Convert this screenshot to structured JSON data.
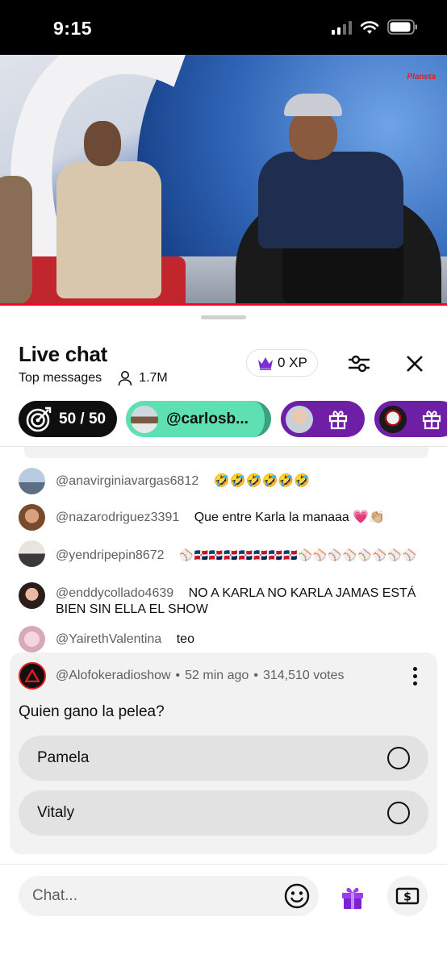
{
  "status_bar": {
    "time": "9:15"
  },
  "video": {
    "channel_logo": "Planeta"
  },
  "chat_panel": {
    "title": "Live chat",
    "mode": "Top messages",
    "viewers": "1.7M",
    "xp": "0 XP",
    "goal_pill": "50 / 50",
    "user_pill": "@carlosb...",
    "accent_colors": {
      "user_pill": "#5fe0b3",
      "gift_pill": "#6f1fa6",
      "progress": "#ff0033"
    }
  },
  "messages": [
    {
      "author": "@anavirginiavargas6812",
      "text": "🤣🤣🤣🤣🤣🤣"
    },
    {
      "author": "@nazarodriguez3391",
      "text": "Que entre Karla la manaaa 💗👏🏼"
    },
    {
      "author": "@yendripepin8672",
      "text": "⚾🇩🇴🇩🇴🇩🇴🇩🇴🇩🇴🇩🇴🇩🇴⚾⚾⚾⚾⚾⚾⚾⚾"
    },
    {
      "author": "@enddycollado4639",
      "text": "NO A KARLA NO KARLA JAMAS ESTÁ BIEN SIN ELLA EL SHOW"
    },
    {
      "author": "@YairethValentina",
      "text": "teo"
    }
  ],
  "poll": {
    "author": "@Alofokeradioshow",
    "time": "52 min ago",
    "votes": "314,510 votes",
    "separator": "•",
    "question": "Quien gano la pelea?",
    "options": [
      "Pamela",
      "Vitaly"
    ]
  },
  "input": {
    "placeholder": "Chat..."
  }
}
